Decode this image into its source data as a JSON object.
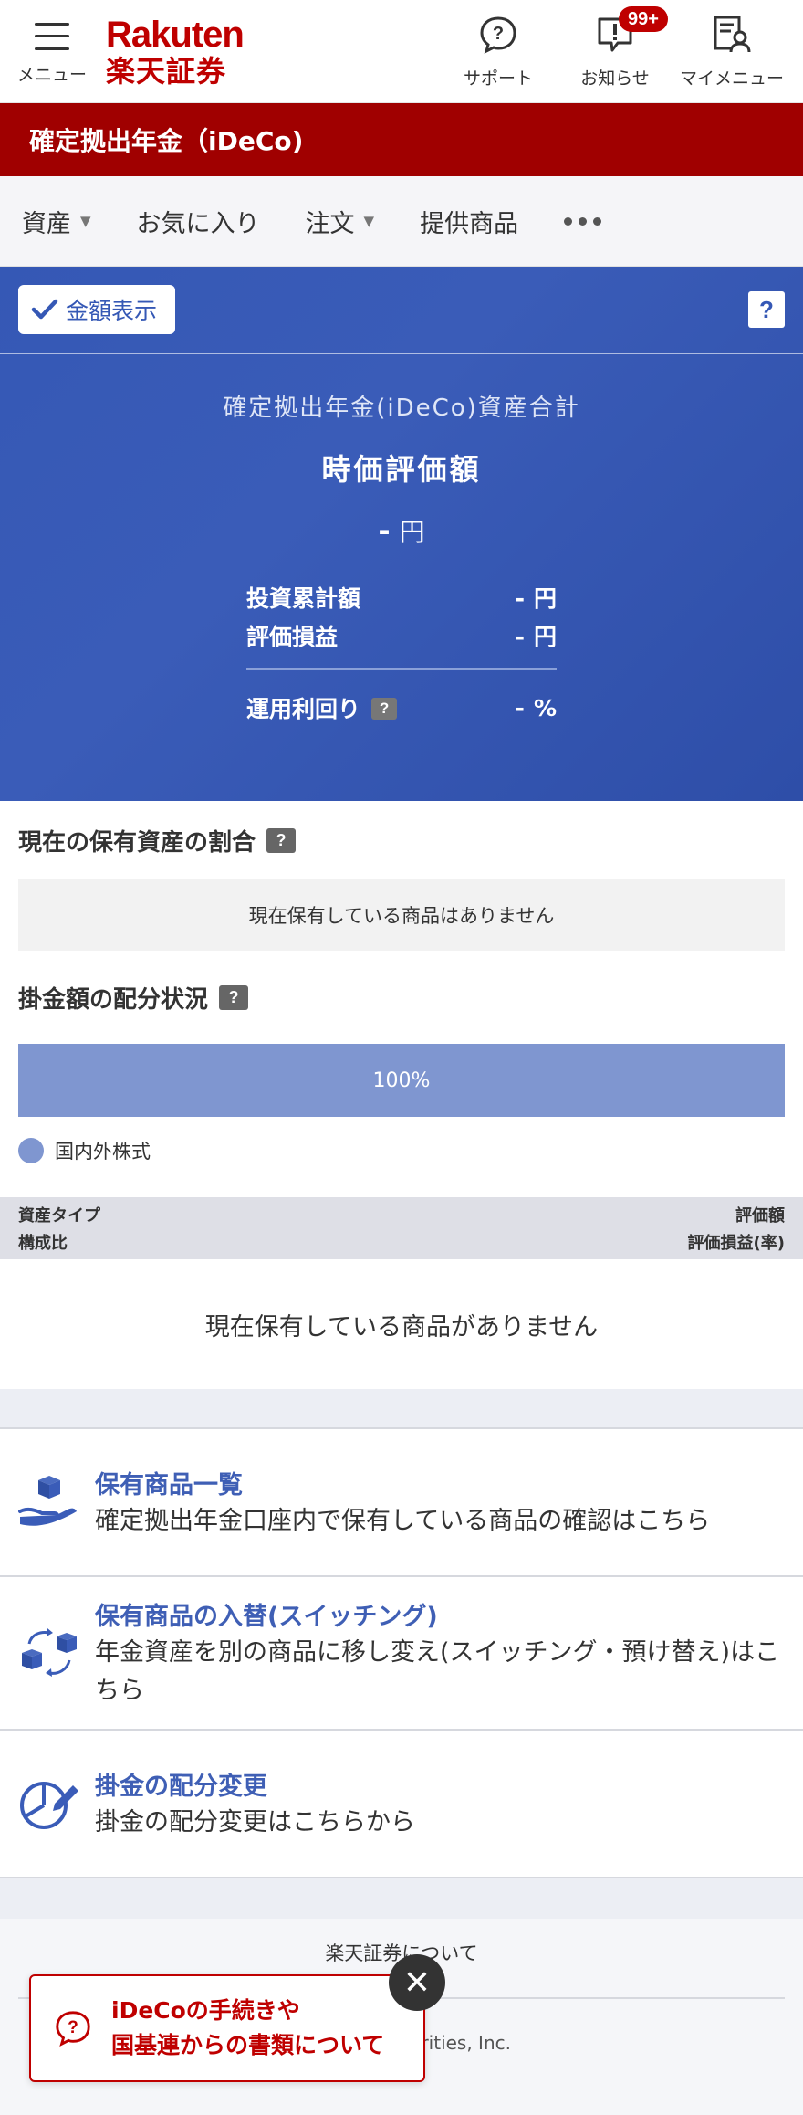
{
  "header": {
    "menu_label": "メニュー",
    "logo_en": "Rakuten",
    "logo_ja": "楽天証券",
    "support_label": "サポート",
    "notice_label": "お知らせ",
    "notice_badge": "99+",
    "mymenu_label": "マイメニュー"
  },
  "title_bar": {
    "title": "確定拠出年金（iDeCo)"
  },
  "nav": {
    "items": [
      "資産",
      "お気に入り",
      "注文",
      "提供商品"
    ]
  },
  "summary": {
    "toggle_label": "金額表示",
    "help": "?",
    "caption": "確定拠出年金(iDeCo)資産合計",
    "heading": "時価評価額",
    "value": "-",
    "unit_yen": "円",
    "rows": [
      {
        "label": "投資累計額",
        "value": "-",
        "unit": "円"
      },
      {
        "label": "評価損益",
        "value": "-",
        "unit": "円"
      }
    ],
    "yield_label": "運用利回り",
    "yield_value": "-",
    "yield_unit": "%"
  },
  "holdings": {
    "title": "現在の保有資産の割合",
    "empty_text": "現在保有している商品はありません"
  },
  "allocation": {
    "title": "掛金額の配分状況",
    "bar_label": "100%",
    "bar_fraction": 1.0,
    "bar_color": "#7f96d0",
    "legend_label": "国内外株式"
  },
  "table": {
    "left_top": "資産タイプ",
    "left_bottom": "構成比",
    "right_top": "評価額",
    "right_bottom": "評価損益(率)",
    "empty_text": "現在保有している商品がありません"
  },
  "links": [
    {
      "title": "保有商品一覧",
      "desc": "確定拠出年金口座内で保有している商品の確認はこちら"
    },
    {
      "title": "保有商品の入替(スイッチング)",
      "desc": "年金資産を別の商品に移し変え(スイッチング・預け替え)はこちら"
    },
    {
      "title": "掛金の配分変更",
      "desc": "掛金の配分変更はこちらから"
    }
  ],
  "footer": {
    "about": "楽天証券について",
    "copyright": "urities, Inc."
  },
  "banner": {
    "line1": "iDeCoの手続きや",
    "line2": "国基連からの書類について",
    "close": "✕"
  },
  "colors": {
    "brand_red": "#bf0000",
    "title_bar": "#a00000",
    "panel_blue": "#3558b5",
    "link_blue": "#3f5fb5"
  }
}
